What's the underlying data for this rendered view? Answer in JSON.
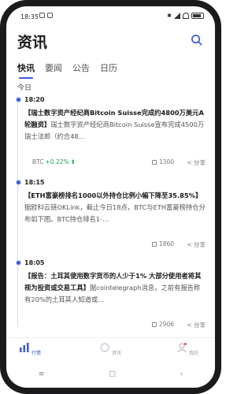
{
  "status": {
    "time": "18:35"
  },
  "header": {
    "title": "资讯"
  },
  "tabs": [
    {
      "label": "快讯"
    },
    {
      "label": "要闻"
    },
    {
      "label": "公告"
    },
    {
      "label": "日历"
    }
  ],
  "section_date": "今日",
  "news": [
    {
      "time": "18:20",
      "headline": "【瑞士数字资产经纪商Bitcoin Suisse完成约4800万美元A轮融资】",
      "body": "瑞士数字资产经纪商Bitcoin Suisse宣布完成4500万瑞士法郎（约合48...",
      "coin": "BTC",
      "change": "+0.22%",
      "views": "1300",
      "share_label": "分享"
    },
    {
      "time": "18:15",
      "headline": "【ETH富豪榜排名1000以外持仓比例小幅下降至35.85%】",
      "body": "据欧科云链OKLink，截止今日18点，BTC与ETH富豪榜持仓分布如下图。BTC持仓排名1-...",
      "views": "1860",
      "share_label": "分享"
    },
    {
      "time": "18:05",
      "headline": "【报告：土耳其使用数字货币的人少于1% 大部分使用者将其视为投资或交易工具】",
      "body": "据cointelegraph消息，之前有报告称有20%的土耳其人知道或...",
      "views": "2906",
      "share_label": "分享"
    }
  ],
  "bottom_nav": [
    {
      "label": "行情"
    },
    {
      "label": "资讯"
    },
    {
      "label": "我的"
    }
  ],
  "colors": {
    "accent": "#3a5bd9",
    "positive": "#1ea65b"
  }
}
